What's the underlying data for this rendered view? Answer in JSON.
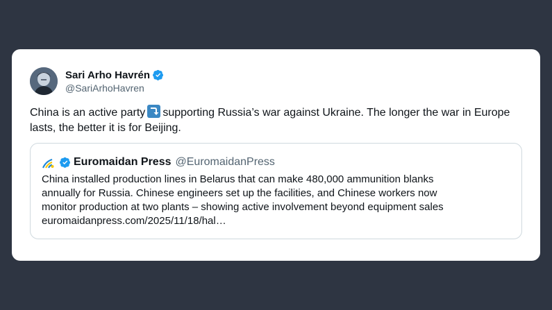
{
  "author": {
    "display_name": "Sari Arho Havrén",
    "handle": "@SariArhoHavren",
    "verified": true
  },
  "tweet": {
    "text_before_emoji": "China is an active party",
    "emoji": "right-arrow-curving-down-emoji",
    "text_after_emoji": "supporting Russia’s war against Ukraine. The longer the war in Europe lasts, the better it is for Beijing."
  },
  "quoted_tweet": {
    "display_name": "Euromaidan Press",
    "handle": "@EuromaidanPress",
    "verified": true,
    "line1": "China installed production lines in Belarus that can make 480,000 ammunition blanks",
    "line2": "annually for Russia. Chinese engineers set up the facilities, and Chinese workers now",
    "line3": "monitor production at two plants – showing active involvement beyond equipment sales",
    "line4": "euromaidanpress.com/2025/11/18/hal…"
  },
  "colors": {
    "background": "#2e3542",
    "card": "#ffffff",
    "verified_blue": "#1d9bf0",
    "text": "#0f1419",
    "secondary_text": "#536471"
  }
}
